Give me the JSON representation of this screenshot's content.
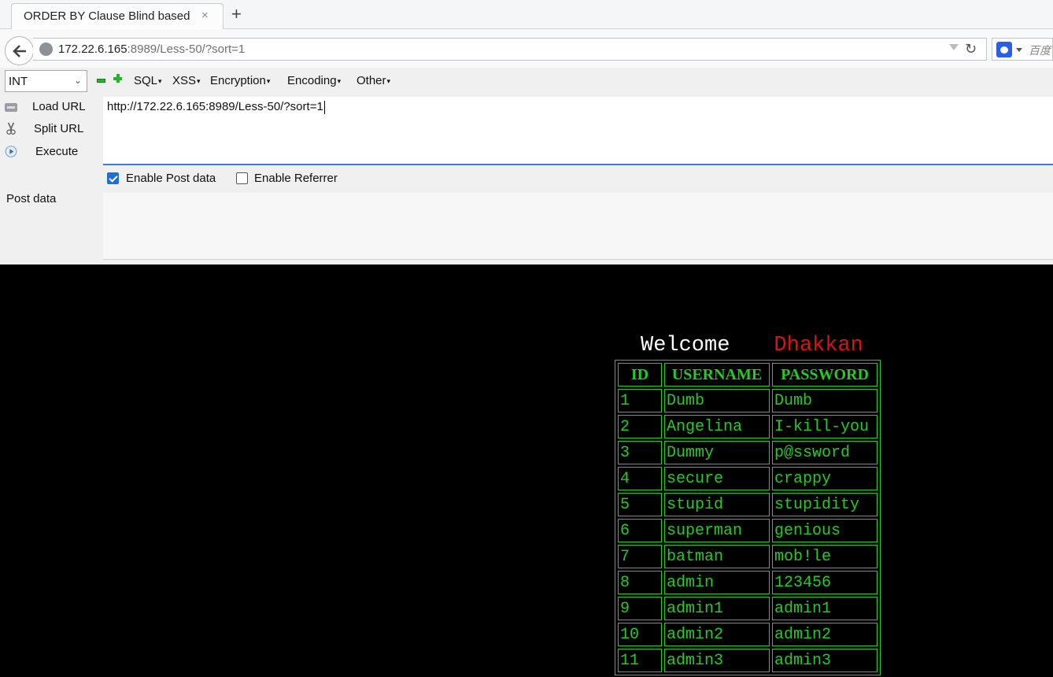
{
  "browser": {
    "tab_title": "ORDER BY Clause Blind based",
    "tab_close": "×",
    "new_tab": "+",
    "url_host": "172.22.6.165",
    "url_rest": ":8989/Less-50/?sort=1",
    "search_engine": "百度"
  },
  "hackbar": {
    "mode_value": "INT",
    "menus": [
      "SQL",
      "XSS",
      "Encryption",
      "Encoding",
      "Other"
    ],
    "load_url": "Load URL",
    "split_url": "Split URL",
    "execute": "Execute",
    "url_value": "http://172.22.6.165:8989/Less-50/?sort=1",
    "enable_post": "Enable Post data",
    "enable_post_checked": true,
    "enable_referrer": "Enable Referrer",
    "enable_referrer_checked": false,
    "post_label": "Post data",
    "post_value": ""
  },
  "page": {
    "welcome": "Welcome",
    "name": "Dhakkan",
    "columns": [
      "ID",
      "USERNAME",
      "PASSWORD"
    ],
    "rows": [
      [
        "1",
        "Dumb",
        "Dumb"
      ],
      [
        "2",
        "Angelina",
        "I-kill-you"
      ],
      [
        "3",
        "Dummy",
        "p@ssword"
      ],
      [
        "4",
        "secure",
        "crappy"
      ],
      [
        "5",
        "stupid",
        "stupidity"
      ],
      [
        "6",
        "superman",
        "genious"
      ],
      [
        "7",
        "batman",
        "mob!le"
      ],
      [
        "8",
        "admin",
        "123456"
      ],
      [
        "9",
        "admin1",
        "admin1"
      ],
      [
        "10",
        "admin2",
        "admin2"
      ],
      [
        "11",
        "admin3",
        "admin3"
      ]
    ]
  },
  "colors": {
    "table_green": "#22cc22",
    "name_red": "#dd1111",
    "page_bg": "#000000"
  }
}
